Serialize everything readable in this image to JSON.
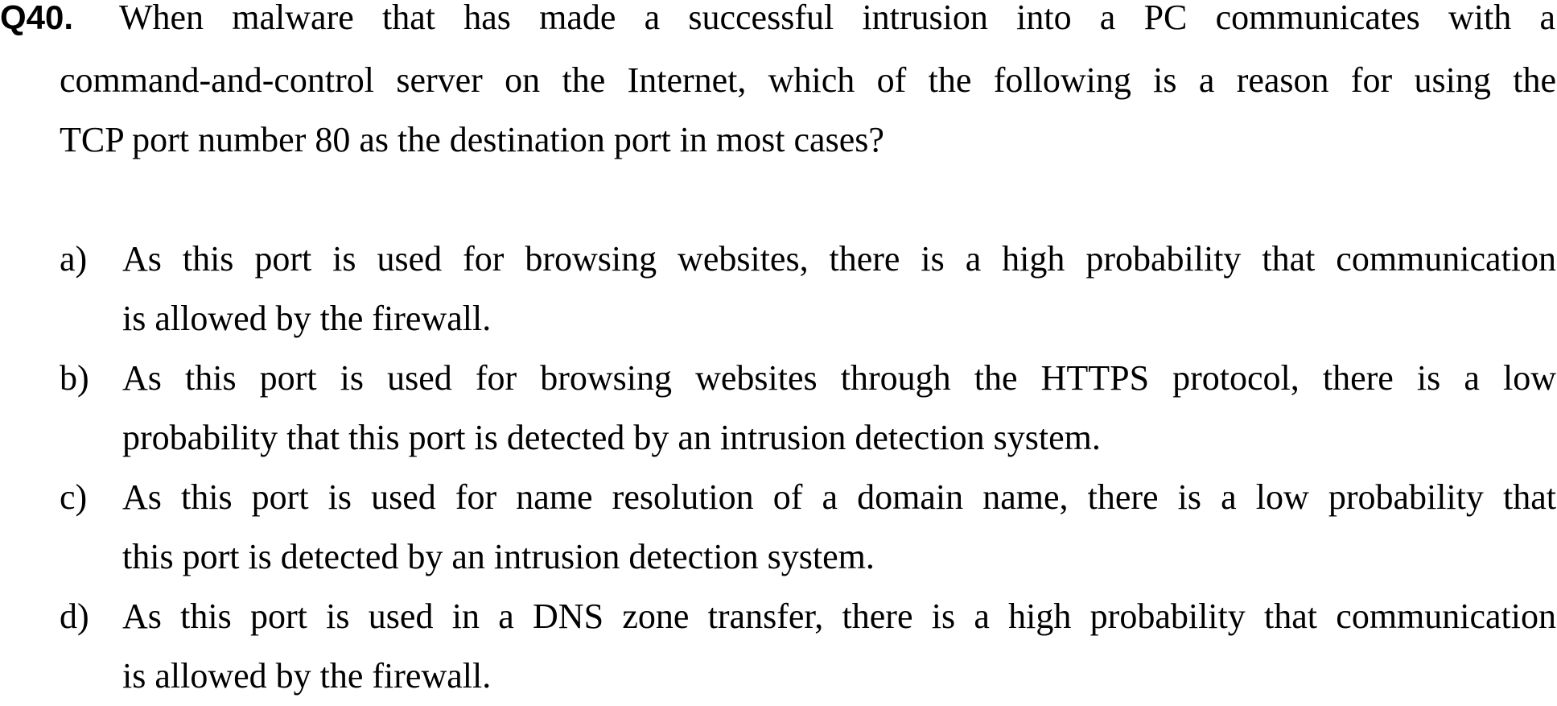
{
  "question": {
    "number": "Q40.",
    "lines": [
      "When malware that has made a successful intrusion into a PC communicates with a",
      "command-and-control server on the Internet, which of the following is a reason for using the",
      "TCP port number 80 as the destination port in most cases?"
    ]
  },
  "options": [
    {
      "letter": "a)",
      "lines": [
        "As this port is used for browsing websites, there is a high probability that communication",
        "is allowed by the firewall."
      ]
    },
    {
      "letter": "b)",
      "lines": [
        "As this port is used for browsing websites through the HTTPS protocol, there is a low",
        "probability that this port is detected by an intrusion detection system."
      ]
    },
    {
      "letter": "c)",
      "lines": [
        "As this port is used for name resolution of a domain name, there is a low probability that",
        "this port is detected by an intrusion detection system."
      ]
    },
    {
      "letter": "d)",
      "lines": [
        "As this port is used in a DNS zone transfer, there is a high probability that communication",
        "is allowed by the firewall."
      ]
    }
  ]
}
